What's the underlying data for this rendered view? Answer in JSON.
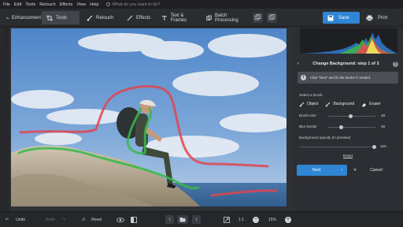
{
  "menu": {
    "items": [
      "File",
      "Edit",
      "Tools",
      "Retouch",
      "Effects",
      "View",
      "Help"
    ],
    "search_placeholder": "What do you want to do?"
  },
  "toolbar": {
    "tabs": [
      {
        "label": "Enhancement",
        "icon": "sliders-icon"
      },
      {
        "label": "Tools",
        "icon": "crop-icon",
        "active": true
      },
      {
        "label": "Retouch",
        "icon": "brush-icon"
      },
      {
        "label": "Effects",
        "icon": "magic-wand-icon"
      },
      {
        "label": "Text & Frames",
        "icon": "text-icon"
      },
      {
        "label": "Batch Processing",
        "icon": "batch-icon"
      }
    ],
    "save_label": "Save",
    "print_label": "Print"
  },
  "panel": {
    "step_title": "Change Background: step 1 of 3",
    "info_text": "Click \"Next\" and fix the border if needed.",
    "brush_heading": "Select a brush:",
    "brushes": [
      "Object",
      "Background",
      "Eraser"
    ],
    "brush_size_label": "Brush size",
    "brush_size_value": "48",
    "blur_label": "Blur border",
    "blur_value": "38",
    "opacity_label": "Background opacity (in preview)",
    "opacity_value": "100",
    "reset_label": "Reset",
    "next_label": "Next",
    "cancel_label": "Cancel"
  },
  "bottom": {
    "undo_label": "Undo",
    "redo_label": "Redo",
    "reset_label": "Reset",
    "zoom_ratio": "1:1",
    "zoom_level": "15%"
  },
  "colors": {
    "accent": "#2f86d4",
    "object_stroke": "#38b84a",
    "background_stroke": "#e0454f"
  }
}
